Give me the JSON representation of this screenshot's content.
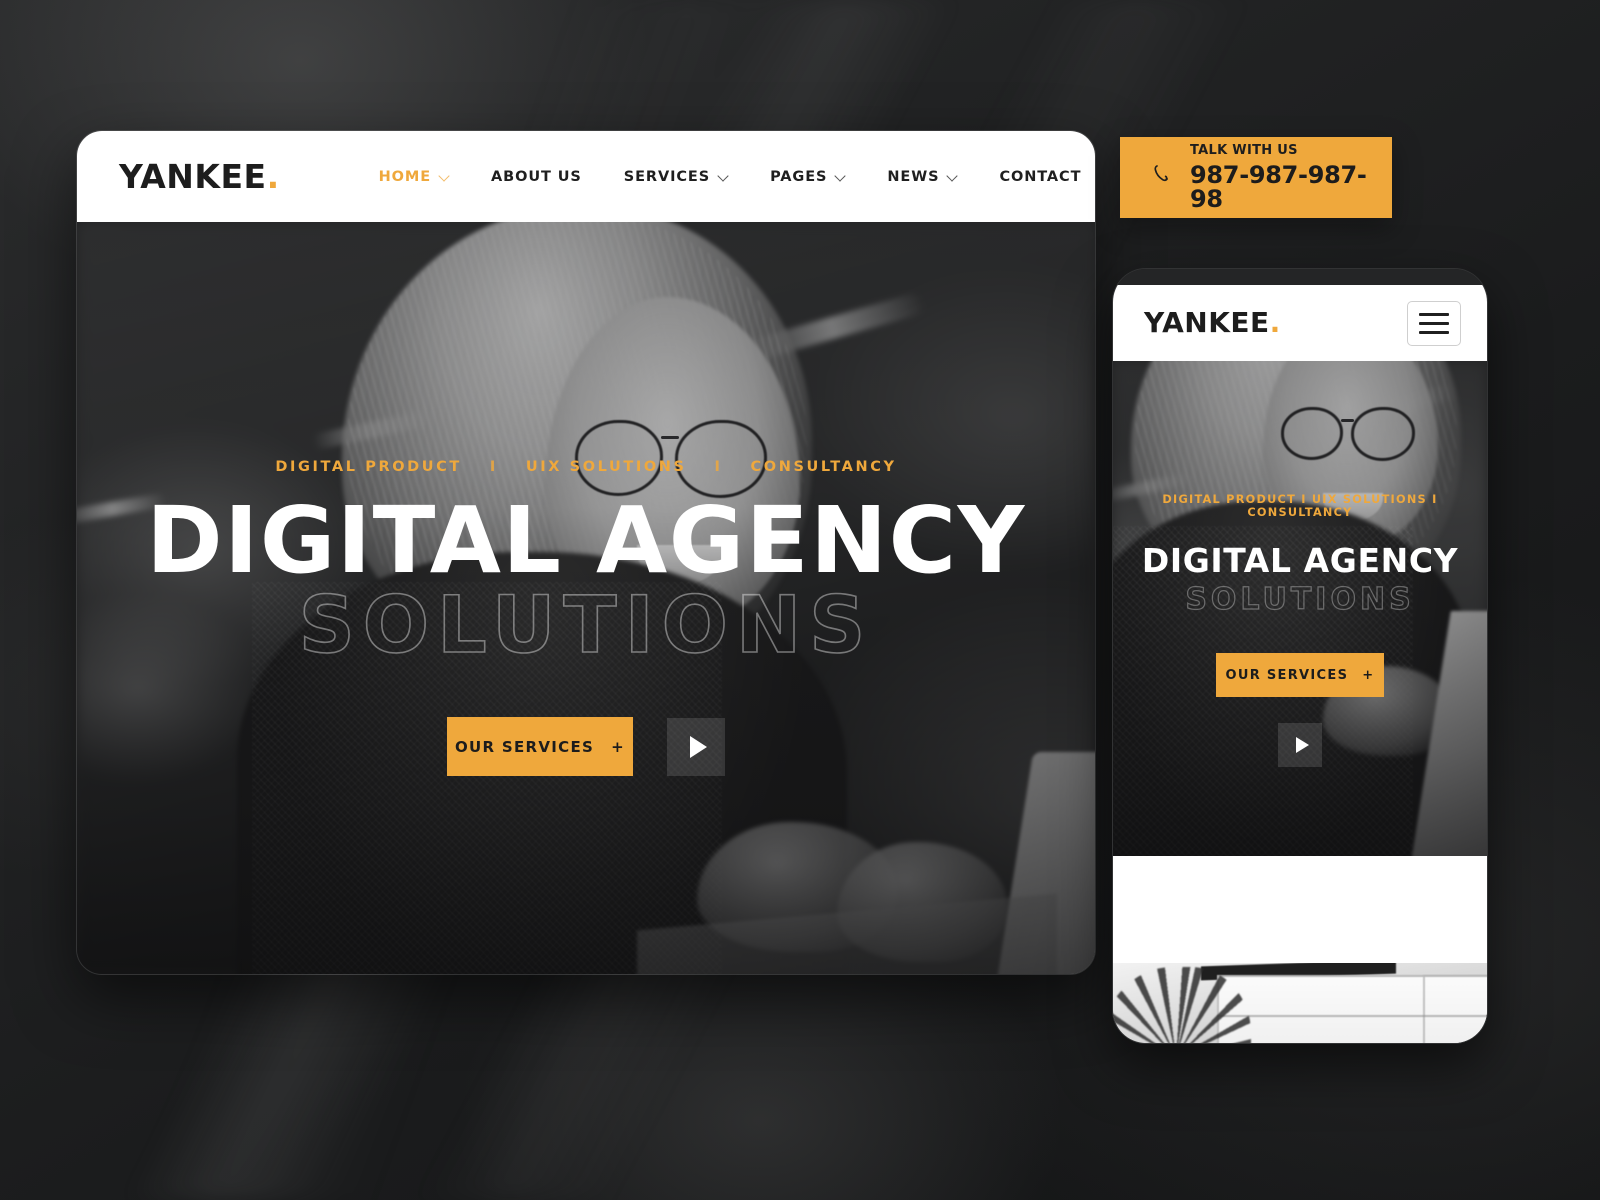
{
  "brand": {
    "name": "YANKEE",
    "dot": ".",
    "accent_color": "#efa83c",
    "dark_color": "#1d1d1d"
  },
  "desktop": {
    "nav": [
      {
        "label": "HOME",
        "has_caret": true,
        "active": true
      },
      {
        "label": "ABOUT US",
        "has_caret": false,
        "active": false
      },
      {
        "label": "SERVICES",
        "has_caret": true,
        "active": false
      },
      {
        "label": "PAGES",
        "has_caret": true,
        "active": false
      },
      {
        "label": "NEWS",
        "has_caret": true,
        "active": false
      },
      {
        "label": "CONTACT",
        "has_caret": false,
        "active": false
      }
    ],
    "search_icon": "search-icon",
    "hero": {
      "tags": [
        "DIGITAL PRODUCT",
        "UIX SOLUTIONS",
        "CONSULTANCY"
      ],
      "separator": "I",
      "headline": "DIGITAL AGENCY",
      "subheadline": "SOLUTIONS",
      "cta_label": "OUR SERVICES",
      "cta_plus": "+",
      "play_icon": "play-icon"
    }
  },
  "talk_panel": {
    "phone_icon": "phone-icon",
    "label": "TALK WITH US",
    "number": "987-987-987-98",
    "background": "#efa83c"
  },
  "mobile": {
    "menu_icon": "hamburger-menu-icon",
    "hero": {
      "tags_line": "DIGITAL PRODUCT I UIX SOLUTIONS I CONSULTANCY",
      "headline": "DIGITAL AGENCY",
      "subheadline": "SOLUTIONS",
      "cta_label": "OUR SERVICES",
      "cta_plus": "+",
      "play_icon": "play-icon"
    }
  }
}
